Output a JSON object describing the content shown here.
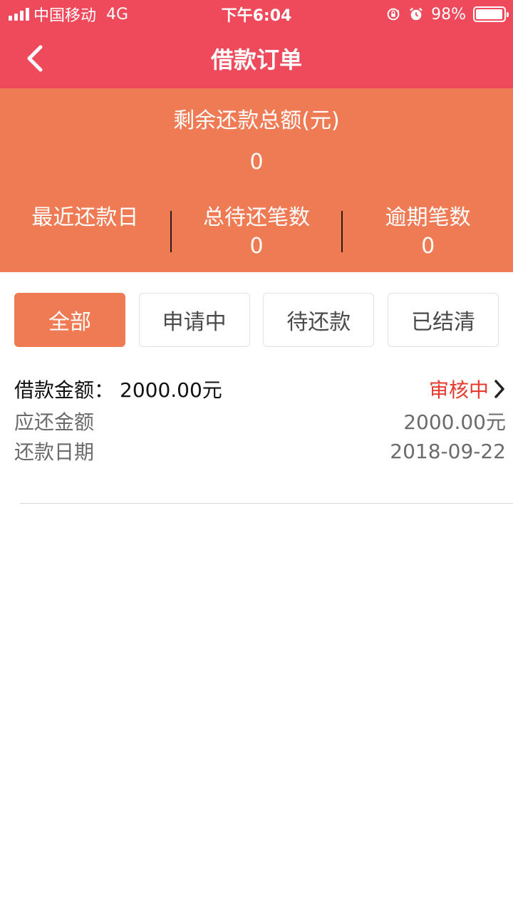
{
  "status_bar": {
    "carrier": "中国移动",
    "network": "4G",
    "time": "下午6:04",
    "battery": "98%",
    "battery_level": 0.98
  },
  "nav": {
    "title": "借款订单",
    "back_icon": "chevron-left-icon"
  },
  "summary": {
    "label": "剩余还款总额(元)",
    "value": "0",
    "stats": [
      {
        "label": "最近还款日",
        "value": ""
      },
      {
        "label": "总待还笔数",
        "value": "0"
      },
      {
        "label": "逾期笔数",
        "value": "0"
      }
    ]
  },
  "tabs": [
    {
      "label": "全部",
      "active": true
    },
    {
      "label": "申请中",
      "active": false
    },
    {
      "label": "待还款",
      "active": false
    },
    {
      "label": "已结清",
      "active": false
    }
  ],
  "order": {
    "amount_label": "借款金额：",
    "amount_value": "2000.00元",
    "status": "审核中",
    "rows": [
      {
        "label": "应还金额",
        "value": "2000.00元"
      },
      {
        "label": "还款日期",
        "value": "2018-09-22"
      }
    ]
  },
  "colors": {
    "header": "#ee4a5c",
    "summary": "#ef7b55",
    "status_text": "#e63b2e"
  }
}
